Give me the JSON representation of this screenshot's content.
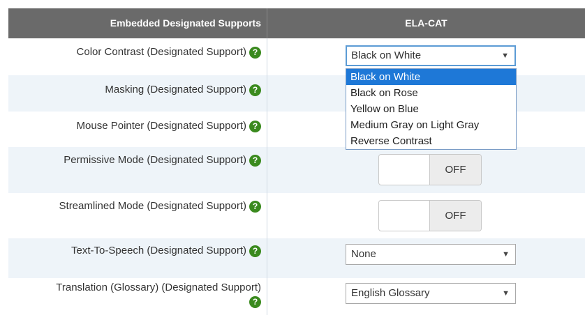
{
  "header": {
    "left_label": "Embedded Designated Supports",
    "right_label": "ELA-CAT"
  },
  "help_glyph": "?",
  "rows": [
    {
      "label": "Color Contrast (Designated Support)",
      "control": "select",
      "value": "Black on White"
    },
    {
      "label": "Masking (Designated Support)"
    },
    {
      "label": "Mouse Pointer (Designated Support)"
    },
    {
      "label": "Permissive Mode (Designated Support)",
      "control": "toggle",
      "value": "OFF"
    },
    {
      "label": "Streamlined Mode (Designated Support)",
      "control": "toggle",
      "value": "OFF"
    },
    {
      "label": "Text-To-Speech (Designated Support)",
      "control": "select",
      "value": "None"
    },
    {
      "label": "Translation (Glossary) (Designated Support)",
      "control": "select",
      "value": "English Glossary"
    }
  ],
  "color_contrast_options": [
    "Black on White",
    "Black on Rose",
    "Yellow on Blue",
    "Medium Gray on Light Gray",
    "Reverse Contrast"
  ],
  "select_arrow": "▼",
  "help_icon": "question-circle-icon",
  "colors": {
    "header_bg": "#6a6a6a",
    "alt_row_bg": "#eef4f9",
    "help_green": "#3a8a1e",
    "selected_option_bg": "#1e78d7",
    "focus_border": "#5b9bd5"
  }
}
